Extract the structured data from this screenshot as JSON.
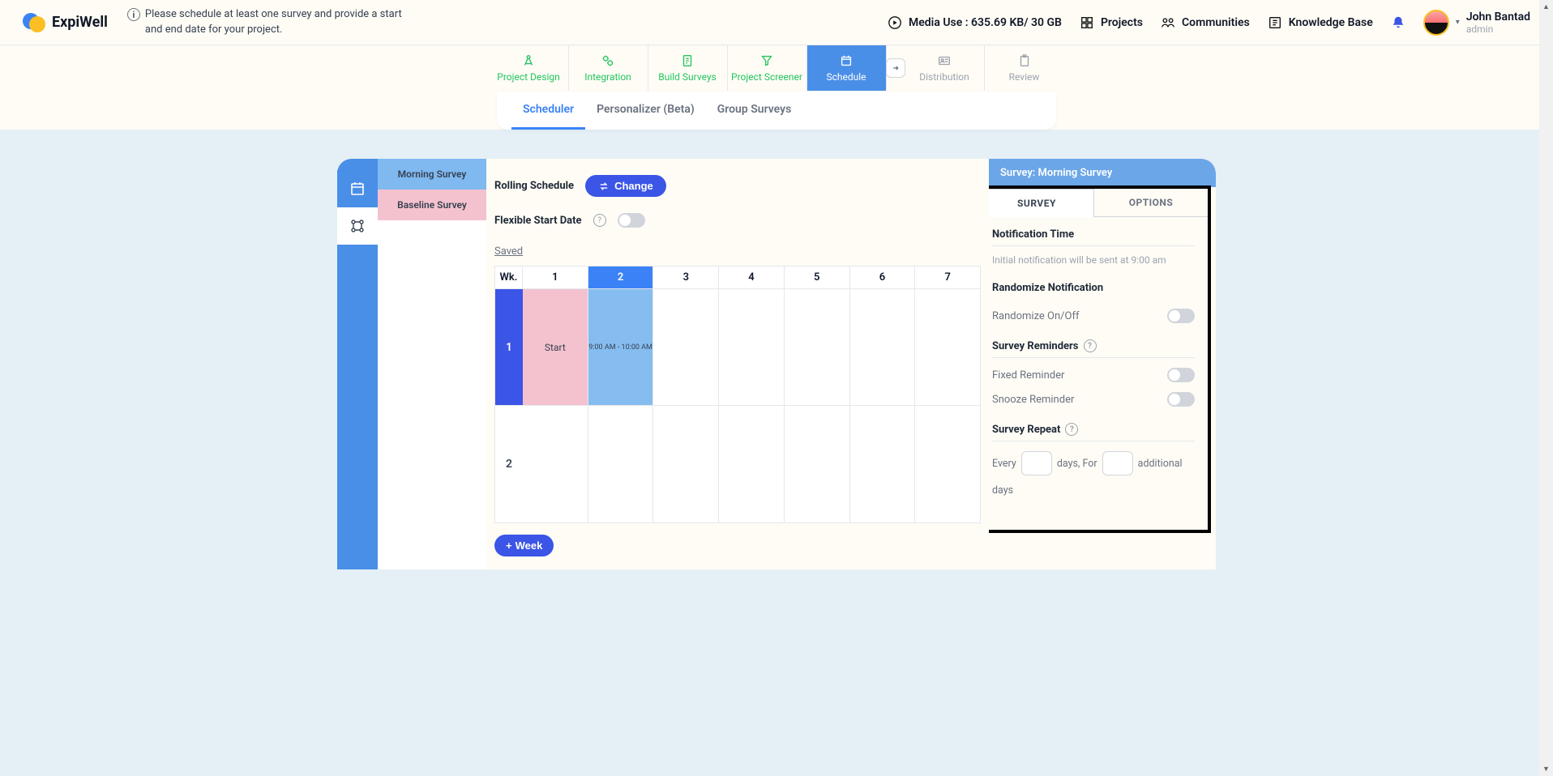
{
  "brand": "ExpiWell",
  "notice": "Please schedule at least one survey and provide a start and end date for your project.",
  "header": {
    "media_use": "Media Use : 635.69 KB/ 30 GB",
    "projects": "Projects",
    "communities": "Communities",
    "knowledge_base": "Knowledge Base"
  },
  "user": {
    "name": "John Bantad",
    "role": "admin"
  },
  "steps": {
    "design": "Project Design",
    "integration": "Integration",
    "build": "Build Surveys",
    "screener": "Project Screener",
    "schedule": "Schedule",
    "distribution": "Distribution",
    "review": "Review"
  },
  "subtabs": {
    "scheduler": "Scheduler",
    "personalizer": "Personalizer (Beta)",
    "group": "Group Surveys"
  },
  "surveys": {
    "morning": "Morning Survey",
    "baseline": "Baseline Survey"
  },
  "controls": {
    "rolling": "Rolling Schedule",
    "change": "Change",
    "flexible": "Flexible Start Date",
    "saved": "Saved",
    "add_week": "Week"
  },
  "calendar": {
    "wk_label": "Wk.",
    "days": [
      "1",
      "2",
      "3",
      "4",
      "5",
      "6",
      "7"
    ],
    "weeks": [
      "1",
      "2"
    ],
    "start_label": "Start",
    "slot_label": "9:00 AM - 10:00 AM"
  },
  "right": {
    "header": "Survey: Morning Survey",
    "tab_survey": "SURVEY",
    "tab_options": "OPTIONS",
    "notif_time": "Notification Time",
    "notif_desc": "Initial notification will be sent at 9:00 am",
    "randomize": "Randomize Notification",
    "randomize_toggle": "Randomize On/Off",
    "reminders": "Survey Reminders",
    "fixed": "Fixed Reminder",
    "snooze": "Snooze Reminder",
    "repeat": "Survey Repeat",
    "every": "Every",
    "days_for": "days, For",
    "additional": "additional",
    "days": "days"
  }
}
